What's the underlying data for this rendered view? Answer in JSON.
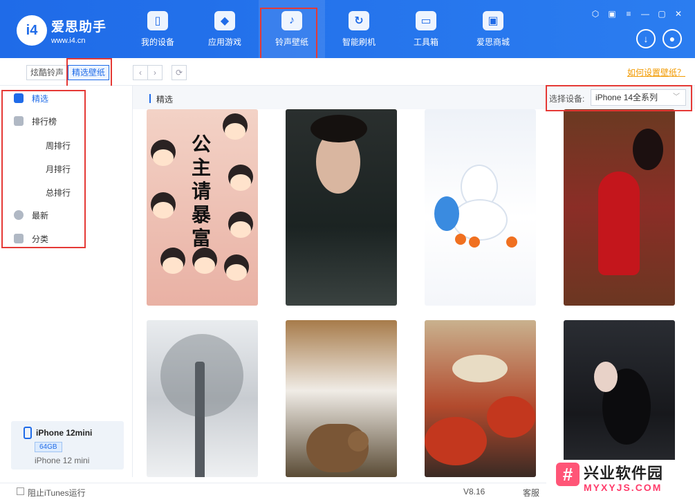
{
  "app": {
    "name": "爱思助手",
    "url": "www.i4.cn",
    "logo_text": "i4"
  },
  "nav": {
    "items": [
      {
        "label": "我的设备",
        "icon": "phone-icon"
      },
      {
        "label": "应用游戏",
        "icon": "cube-icon"
      },
      {
        "label": "铃声壁纸",
        "icon": "music-folder-icon"
      },
      {
        "label": "智能刷机",
        "icon": "flash-icon"
      },
      {
        "label": "工具箱",
        "icon": "toolbox-icon"
      },
      {
        "label": "爱思商城",
        "icon": "shopping-bag-icon"
      }
    ],
    "active_index": 2
  },
  "toolbar": {
    "tab_ringtone": "炫酷铃声",
    "tab_wallpaper": "精选壁纸",
    "help_link": "如何设置壁纸？"
  },
  "sidebar": {
    "items": [
      {
        "label": "精选",
        "icon": "crown-icon"
      },
      {
        "label": "排行榜",
        "icon": "trophy-icon"
      },
      {
        "label": "周排行"
      },
      {
        "label": "月排行"
      },
      {
        "label": "总排行"
      },
      {
        "label": "最新",
        "icon": "new-icon"
      },
      {
        "label": "分类",
        "icon": "category-icon"
      }
    ]
  },
  "device": {
    "name": "iPhone 12mini",
    "capacity": "64GB",
    "model": "iPhone 12 mini"
  },
  "content": {
    "section_title": "精选",
    "select_label": "选择设备:",
    "selected_device": "iPhone 14全系列",
    "w1_text": "公主请暴富"
  },
  "status": {
    "itunes_label": "阻止iTunes运行",
    "version": "V8.16",
    "service": "客服"
  },
  "watermark": {
    "name": "兴业软件园",
    "url": "MYXYJS.COM",
    "logo_char": "#"
  }
}
